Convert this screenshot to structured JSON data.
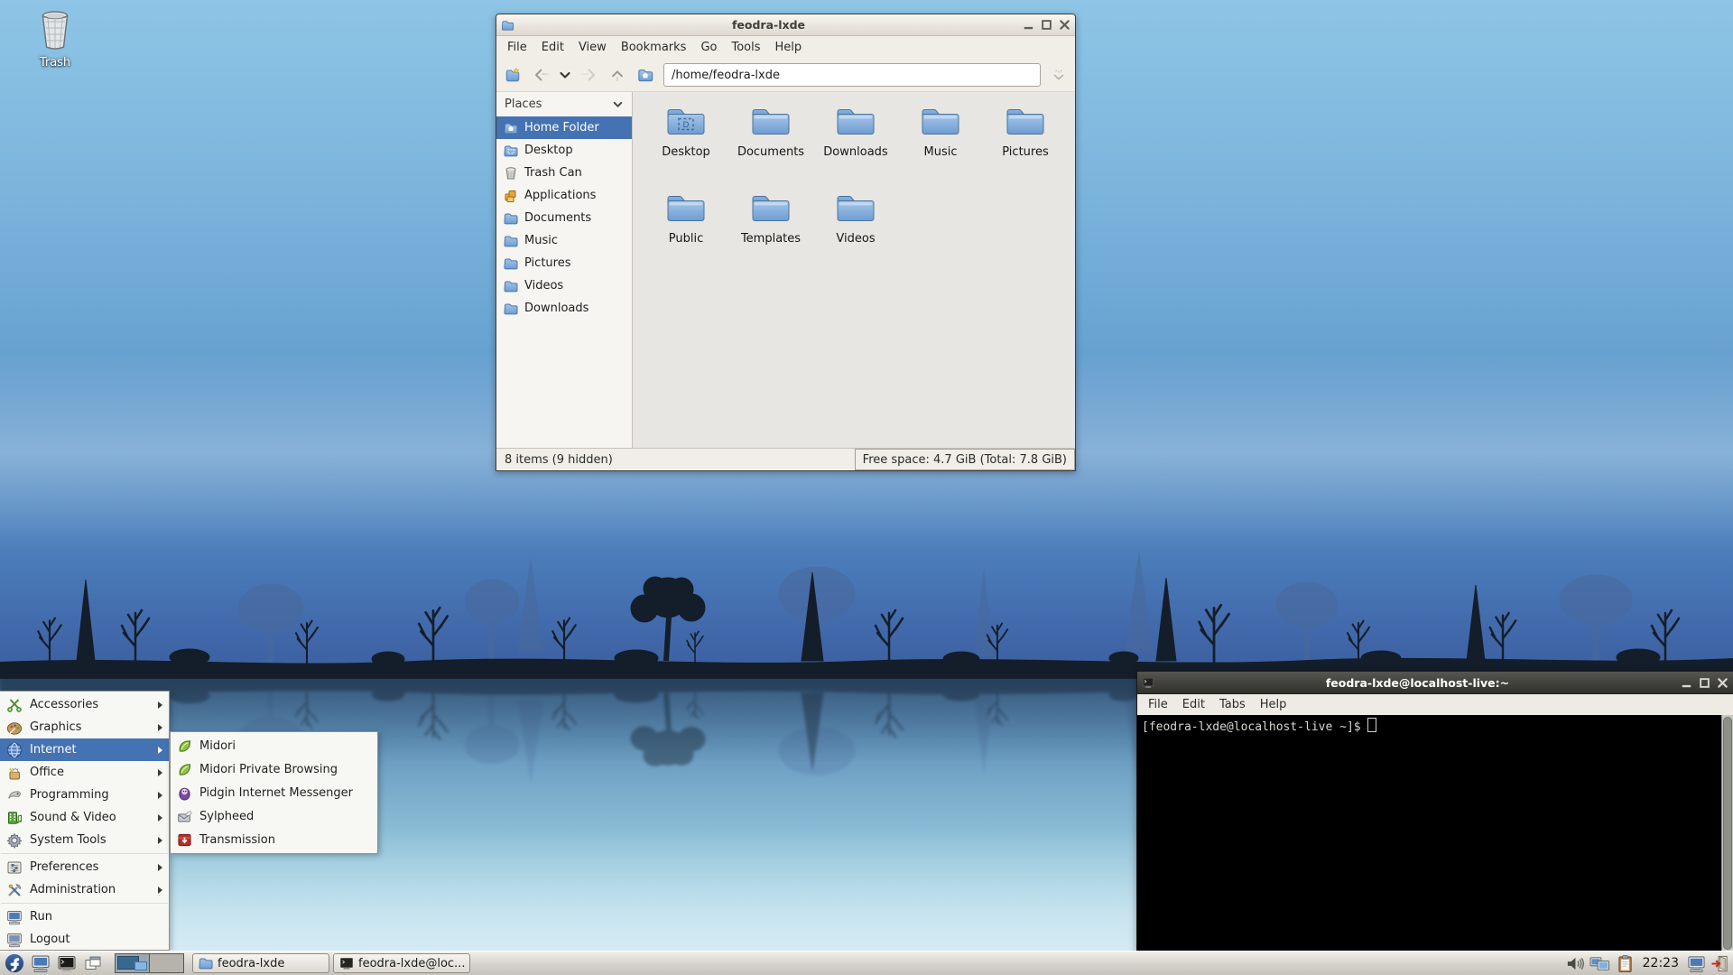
{
  "colors": {
    "selection": "#4472b2",
    "folder_blue": "#7aa6d8",
    "fedora_blue": "#29457f",
    "terminal_bg": "#000000",
    "taskbar_bg": "#d5d2cc"
  },
  "desktop": {
    "trash_label": "Trash"
  },
  "file_manager": {
    "title": "feodra-lxde",
    "menu": [
      "File",
      "Edit",
      "View",
      "Bookmarks",
      "Go",
      "Tools",
      "Help"
    ],
    "path": "/home/feodra-lxde",
    "places_header": "Places",
    "places": [
      {
        "label": "Home Folder",
        "icon": "home-folder-icon",
        "selected": true
      },
      {
        "label": "Desktop",
        "icon": "desktop-folder-icon",
        "selected": false
      },
      {
        "label": "Trash Can",
        "icon": "trash-small-icon",
        "selected": false
      },
      {
        "label": "Applications",
        "icon": "applications-icon",
        "selected": false
      },
      {
        "label": "Documents",
        "icon": "folder-small-icon",
        "selected": false
      },
      {
        "label": "Music",
        "icon": "folder-small-icon",
        "selected": false
      },
      {
        "label": "Pictures",
        "icon": "folder-small-icon",
        "selected": false
      },
      {
        "label": "Videos",
        "icon": "folder-small-icon",
        "selected": false
      },
      {
        "label": "Downloads",
        "icon": "folder-small-icon",
        "selected": false
      }
    ],
    "folders": [
      "Desktop",
      "Documents",
      "Downloads",
      "Music",
      "Pictures",
      "Public",
      "Templates",
      "Videos"
    ],
    "status_left": "8 items (9 hidden)",
    "status_right": "Free space: 4.7 GiB (Total: 7.8 GiB)"
  },
  "terminal": {
    "title": "feodra-lxde@localhost-live:~",
    "menu": [
      "File",
      "Edit",
      "Tabs",
      "Help"
    ],
    "prompt": "[feodra-lxde@localhost-live ~]$"
  },
  "app_menu": {
    "items": [
      {
        "label": "Accessories",
        "icon": "accessories-icon",
        "submenu": true
      },
      {
        "label": "Graphics",
        "icon": "graphics-icon",
        "submenu": true
      },
      {
        "label": "Internet",
        "icon": "internet-icon",
        "submenu": true,
        "selected": true
      },
      {
        "label": "Office",
        "icon": "office-icon",
        "submenu": true
      },
      {
        "label": "Programming",
        "icon": "programming-icon",
        "submenu": true
      },
      {
        "label": "Sound & Video",
        "icon": "sound-video-icon",
        "submenu": true
      },
      {
        "label": "System Tools",
        "icon": "system-tools-icon",
        "submenu": true
      },
      {
        "separator": true
      },
      {
        "label": "Preferences",
        "icon": "preferences-icon",
        "submenu": true
      },
      {
        "label": "Administration",
        "icon": "administration-icon",
        "submenu": true
      },
      {
        "separator": true
      },
      {
        "label": "Run",
        "icon": "run-icon",
        "submenu": false
      },
      {
        "label": "Logout",
        "icon": "logout-icon",
        "submenu": false
      }
    ],
    "submenu": [
      {
        "label": "Midori",
        "icon": "midori-icon"
      },
      {
        "label": "Midori Private Browsing",
        "icon": "midori-icon"
      },
      {
        "label": "Pidgin Internet Messenger",
        "icon": "pidgin-icon"
      },
      {
        "label": "Sylpheed",
        "icon": "sylpheed-icon"
      },
      {
        "label": "Transmission",
        "icon": "transmission-icon"
      }
    ]
  },
  "taskbar": {
    "tasks": [
      {
        "label": "feodra-lxde",
        "icon": "folder-small-icon"
      },
      {
        "label": "feodra-lxde@loc...",
        "icon": "terminal-mini-icon"
      }
    ],
    "clock": "22:23"
  }
}
